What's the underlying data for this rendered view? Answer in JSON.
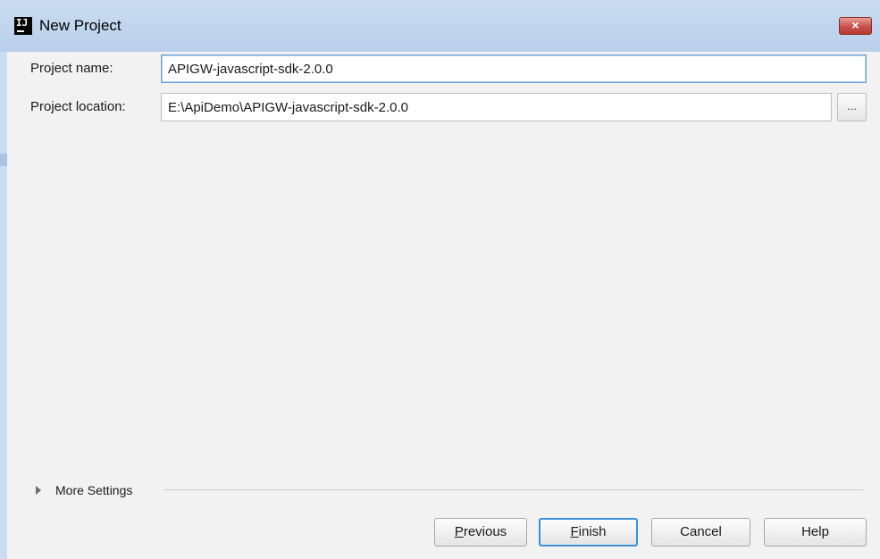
{
  "window": {
    "title": "New Project",
    "app_icon_text": "IJ",
    "close_label": "×"
  },
  "form": {
    "project_name_label": "Project name:",
    "project_name_value": "APIGW-javascript-sdk-2.0.0",
    "project_location_label": "Project location:",
    "project_location_value": "E:\\ApiDemo\\APIGW-javascript-sdk-2.0.0",
    "browse_label": "..."
  },
  "more_settings": {
    "label": "More Settings",
    "icon": "triangle-right-icon"
  },
  "buttons": {
    "previous": {
      "mnemonic": "P",
      "rest": "revious"
    },
    "finish": {
      "mnemonic": "F",
      "rest": "inish"
    },
    "cancel": "Cancel",
    "help": "Help"
  },
  "colors": {
    "titlebar": "#c9dcf1",
    "close_button": "#c75050",
    "focus_border": "#3d8fd8",
    "background": "#f2f2f2"
  }
}
